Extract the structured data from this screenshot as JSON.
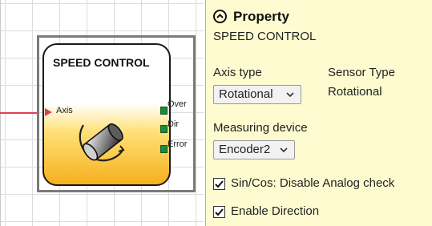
{
  "block": {
    "title": "SPEED CONTROL",
    "input_label": "Axis",
    "outputs": [
      "Over",
      "Dir",
      "Error"
    ]
  },
  "panel": {
    "title": "Property",
    "block_name": "SPEED CONTROL",
    "axis_type": {
      "label": "Axis type",
      "value": "Rotational"
    },
    "sensor_type": {
      "label": "Sensor Type",
      "value": "Rotational"
    },
    "measuring_device": {
      "label": "Measuring device",
      "value": "Encoder2"
    },
    "checkboxes": [
      {
        "label": "Sin/Cos: Disable Analog check",
        "checked": true
      },
      {
        "label": "Enable Direction",
        "checked": true
      }
    ]
  },
  "colors": {
    "panel_background": "#fefbd0",
    "input_pin": "#e04050",
    "output_pin": "#1d8a3a",
    "block_gradient_bottom": "#f6b01c"
  },
  "icons": {
    "collapse": "chevron-up-circle-icon",
    "dropdown": "chevron-down-icon",
    "block": "rotation-cylinder-icon",
    "check": "checkmark-icon"
  }
}
